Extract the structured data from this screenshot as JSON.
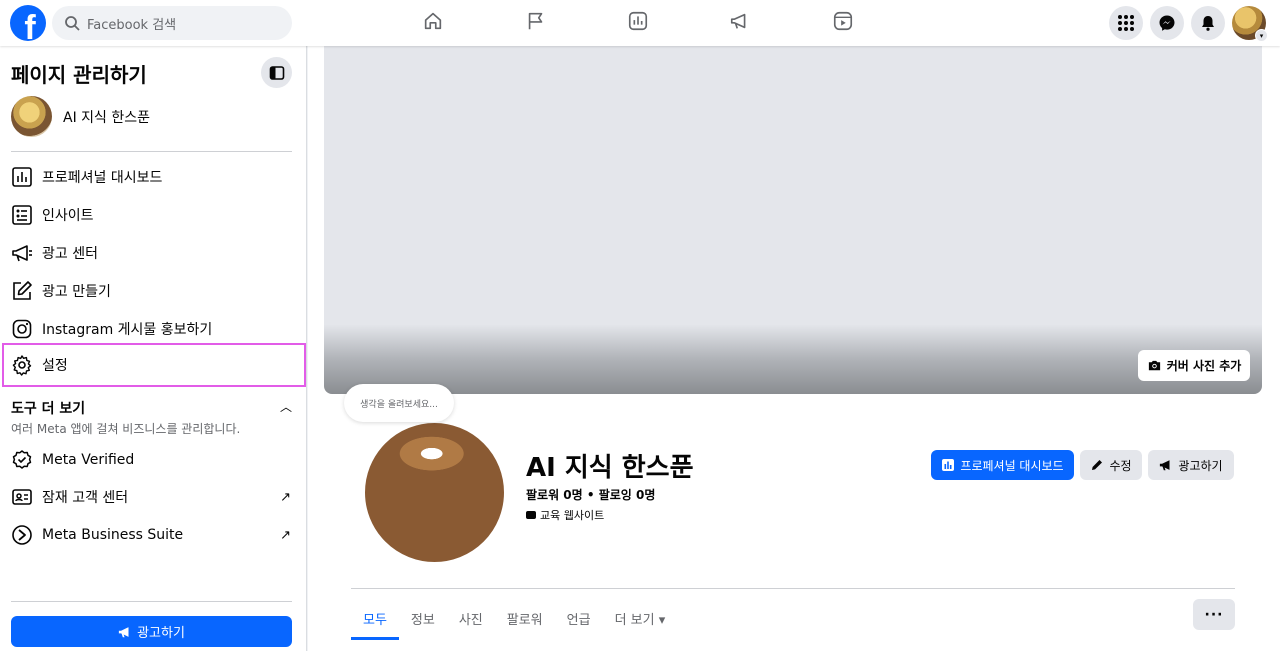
{
  "topbar": {
    "logo": "f",
    "search_placeholder": "Facebook 검색",
    "nav_icons": [
      "home-icon",
      "flag-icon",
      "insights-icon",
      "megaphone-icon",
      "reels-icon"
    ],
    "right_icons": [
      "menu-grid-icon",
      "messenger-icon",
      "bell-icon"
    ]
  },
  "sidebar": {
    "title": "페이지 관리하기",
    "page_name": "AI 지식 한스푼",
    "items": [
      {
        "label": "프로페셔널 대시보드",
        "icon": "dashboard-icon"
      },
      {
        "label": "인사이트",
        "icon": "insights-icon"
      },
      {
        "label": "광고 센터",
        "icon": "megaphone-icon"
      },
      {
        "label": "광고 만들기",
        "icon": "edit-icon"
      },
      {
        "label": "Instagram 게시물 홍보하기",
        "icon": "instagram-icon"
      },
      {
        "label": "설정",
        "icon": "gear-icon"
      }
    ],
    "tools_title": "도구 더 보기",
    "tools_subtitle": "여러 Meta 앱에 걸쳐 비즈니스를 관리합니다.",
    "tools": [
      {
        "label": "Meta Verified",
        "icon": "verified-icon"
      },
      {
        "label": "잠재 고객 센터",
        "icon": "contact-card-icon",
        "external": "↗"
      },
      {
        "label": "Meta Business Suite",
        "icon": "business-suite-icon",
        "external": "↗"
      }
    ],
    "ad_button": "광고하기"
  },
  "main": {
    "cover_button": "커버 사진 추가",
    "bubble": "생각을 올려보세요...",
    "page_name": "AI 지식 한스푼",
    "stats": "팔로워 0명 • 팔로잉 0명",
    "category": "교육 웹사이트",
    "buttons": {
      "dashboard": "프로페셔널 대시보드",
      "edit": "수정",
      "advertise": "광고하기"
    },
    "tabs": [
      "모두",
      "정보",
      "사진",
      "팔로워",
      "언급",
      "더 보기 ▾"
    ],
    "more": "···"
  },
  "colors": {
    "accent": "#0866ff",
    "highlight_outline": "#e25ce8"
  }
}
